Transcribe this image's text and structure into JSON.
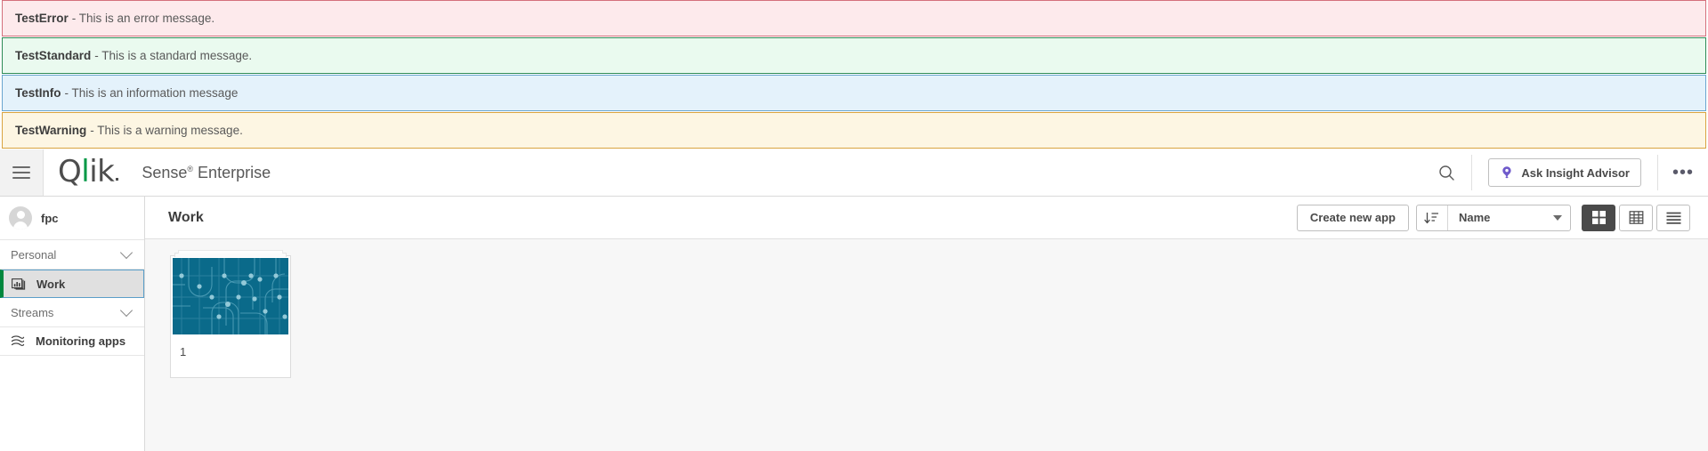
{
  "alerts": [
    {
      "type": "error",
      "title": "TestError",
      "message": "- This is an error message."
    },
    {
      "type": "standard",
      "title": "TestStandard",
      "message": "- This is a standard message."
    },
    {
      "type": "info",
      "title": "TestInfo",
      "message": "- This is an information message"
    },
    {
      "type": "warning",
      "title": "TestWarning",
      "message": "- This is a warning message."
    }
  ],
  "topbar": {
    "menu_icon": "hamburger-icon",
    "logo_q": "Q",
    "logo_l": "l",
    "logo_ik": "ik",
    "product_name": "Sense",
    "product_sup": "®",
    "product_suffix": " Enterprise",
    "search_icon": "search-icon",
    "insight_icon": "insight-advisor-icon",
    "insight_label": "Ask Insight Advisor",
    "more_label": "•••",
    "more_icon": "ellipsis-icon",
    "accent_green": "#009845",
    "insight_purple": "#6f5acb"
  },
  "sidebar": {
    "user": {
      "name": "fpc",
      "avatar_icon": "user-avatar-icon"
    },
    "groups": [
      {
        "label": "Personal",
        "chevron_icon": "chevron-down-icon"
      },
      {
        "label": "Streams",
        "chevron_icon": "chevron-down-icon"
      }
    ],
    "work_item": {
      "label": "Work",
      "icon": "app-chart-icon",
      "selected": true
    },
    "monitoring_item": {
      "label": "Monitoring apps",
      "icon": "stream-waves-icon"
    },
    "selected_accent": "#00873d"
  },
  "main": {
    "title": "Work",
    "create_button": "Create new app",
    "sort_direction_icon": "sort-descending-icon",
    "sort_field": "Name",
    "sort_caret_icon": "caret-down-icon",
    "views": [
      {
        "name": "grid-view",
        "icon": "grid-icon",
        "active": true
      },
      {
        "name": "table-view",
        "icon": "table-icon",
        "active": false
      },
      {
        "name": "list-view",
        "icon": "list-icon",
        "active": false
      }
    ],
    "apps": [
      {
        "name": "1",
        "thumb_color": "#0a6a8a",
        "thumb_icon": "app-default-thumbnail"
      }
    ]
  }
}
